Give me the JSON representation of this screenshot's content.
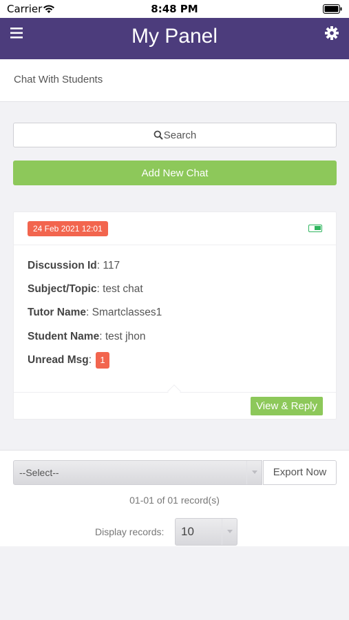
{
  "status_bar": {
    "carrier": "Carrier",
    "time": "8:48 PM"
  },
  "header": {
    "title": "My Panel",
    "menu_icon": "hamburger-menu-icon",
    "settings_icon": "gear-icon",
    "background_color": "#4c3c7c"
  },
  "subheader": {
    "title": "Chat With Students"
  },
  "search": {
    "label": "Search",
    "icon": "search-icon"
  },
  "add_chat": {
    "label": "Add New Chat",
    "color": "#8dc85a"
  },
  "chat_card": {
    "date": "24 Feb 2021 12:01",
    "toggle_on": true,
    "fields": [
      {
        "label": "Discussion Id",
        "value": "117"
      },
      {
        "label": "Subject/Topic",
        "value": "test chat"
      },
      {
        "label": "Tutor Name",
        "value": "Smartclasses1"
      },
      {
        "label": "Student Name",
        "value": "test jhon"
      }
    ],
    "unread": {
      "label": "Unread Msg",
      "value": "1"
    },
    "view_reply_label": "View & Reply"
  },
  "footer": {
    "select_value": "--Select--",
    "export_label": "Export Now",
    "record_info": "01-01 of 01 record(s)",
    "display_label": "Display records:",
    "display_value": "10"
  }
}
